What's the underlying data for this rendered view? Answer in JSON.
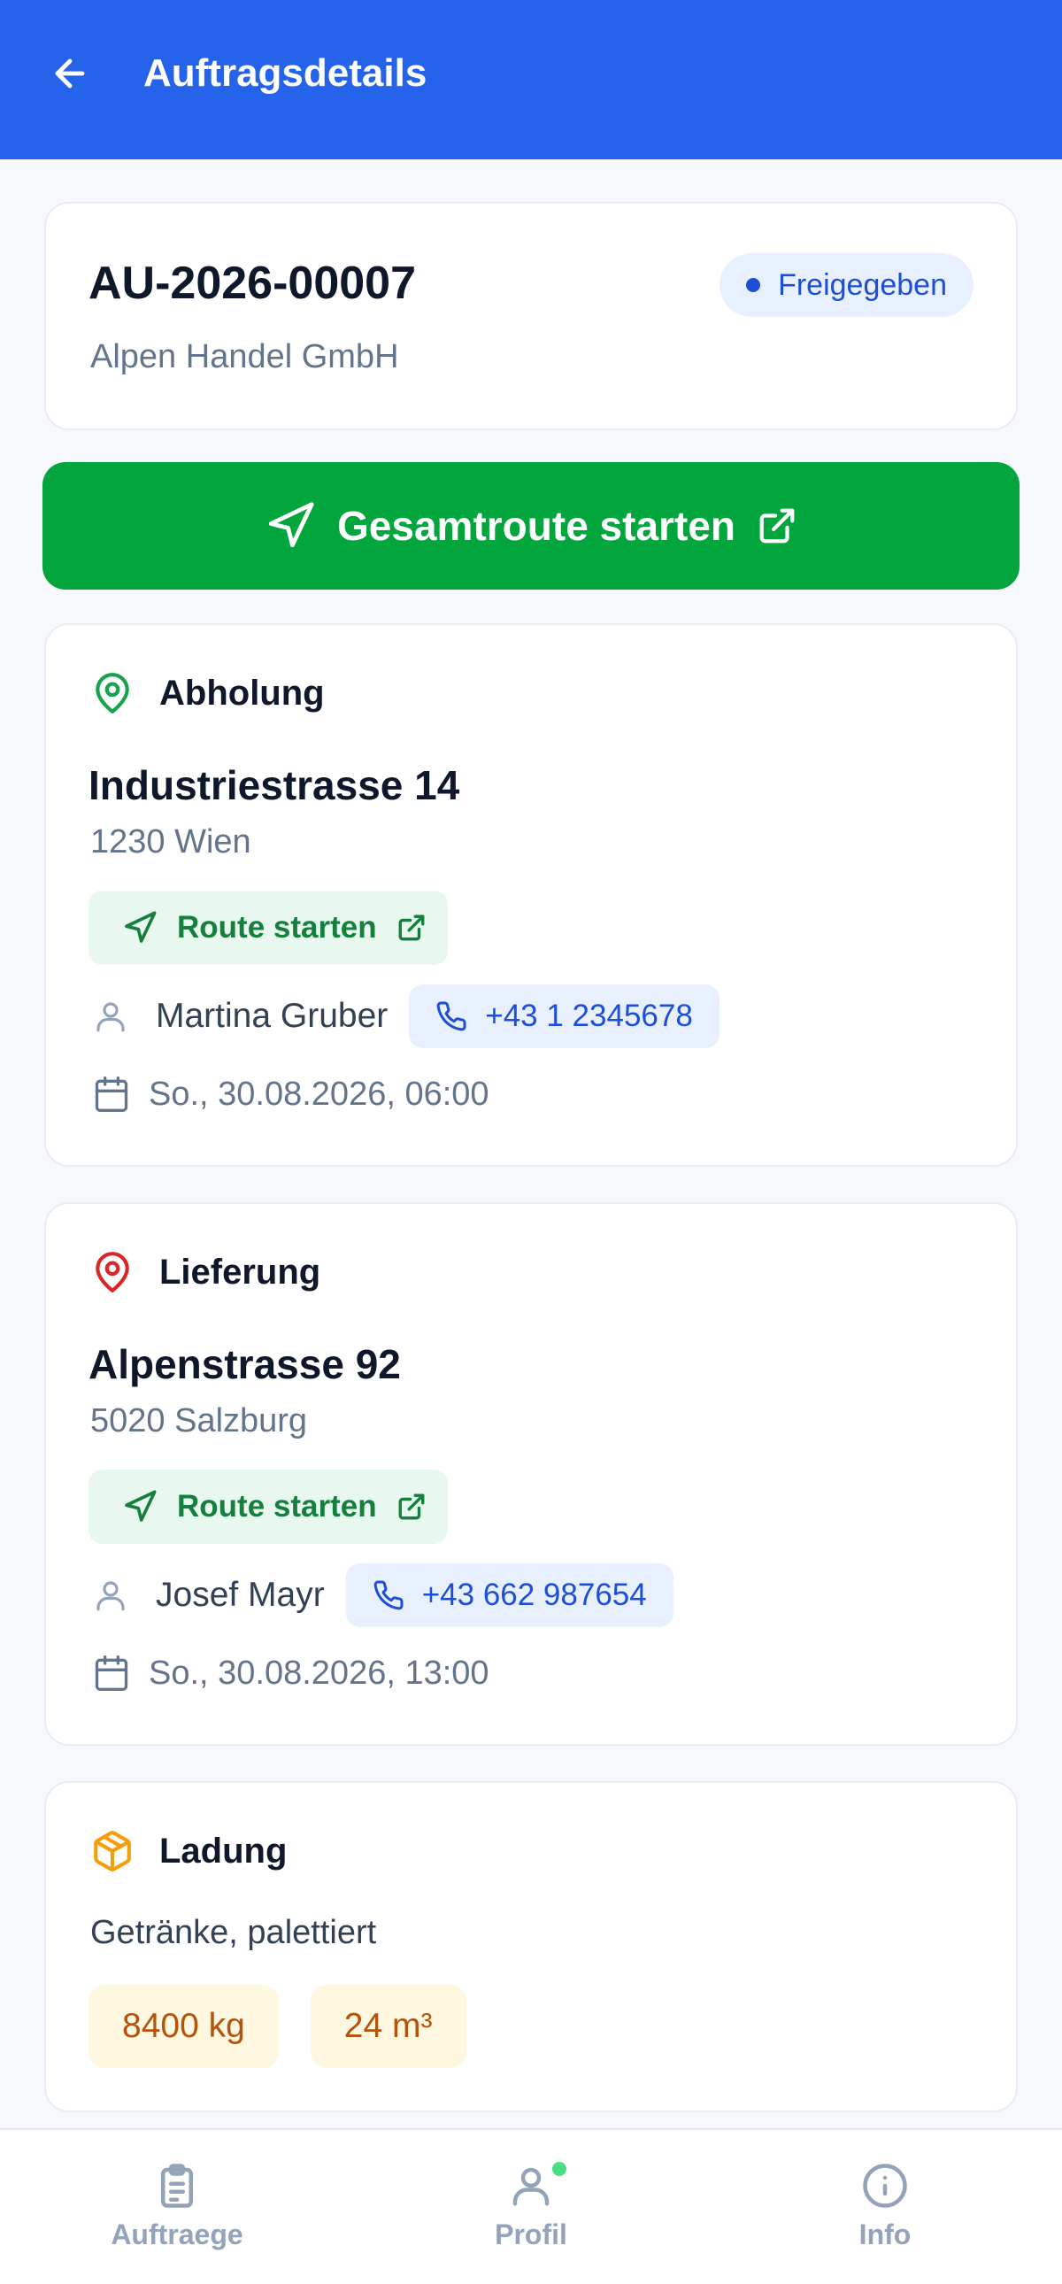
{
  "appbar": {
    "title": "Auftragsdetails"
  },
  "order": {
    "number": "AU-2026-00007",
    "customer": "Alpen Handel GmbH",
    "status": "Freigegeben"
  },
  "route_all": {
    "label": "Gesamtroute starten"
  },
  "pickup": {
    "heading": "Abholung",
    "street": "Industriestrasse 14",
    "city": "1230 Wien",
    "route_label": "Route starten",
    "contact_name": "Martina Gruber",
    "phone": "+43 1 2345678",
    "datetime": "So., 30.08.2026, 06:00"
  },
  "delivery": {
    "heading": "Lieferung",
    "street": "Alpenstrasse 92",
    "city": "5020 Salzburg",
    "route_label": "Route starten",
    "contact_name": "Josef Mayr",
    "phone": "+43 662 987654",
    "datetime": "So., 30.08.2026, 13:00"
  },
  "cargo": {
    "heading": "Ladung",
    "description": "Getränke, palettiert",
    "weight": "8400 kg",
    "volume": "24 m³"
  },
  "nav": {
    "orders": "Auftraege",
    "profile": "Profil",
    "info": "Info"
  },
  "colors": {
    "primary": "#2563eb",
    "success": "#02a63c",
    "pickup_icon": "#16a34a",
    "delivery_icon": "#dc2626",
    "cargo_icon": "#f59e0b"
  }
}
